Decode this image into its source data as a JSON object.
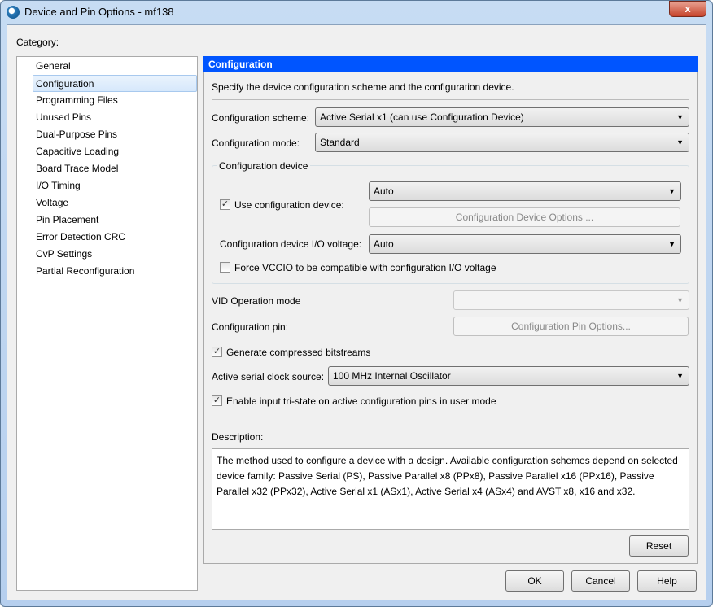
{
  "window": {
    "title": "Device and Pin Options - mf138",
    "close": "x"
  },
  "category_label": "Category:",
  "categories": [
    "General",
    "Configuration",
    "Programming Files",
    "Unused Pins",
    "Dual-Purpose Pins",
    "Capacitive Loading",
    "Board Trace Model",
    "I/O Timing",
    "Voltage",
    "Pin Placement",
    "Error Detection CRC",
    "CvP Settings",
    "Partial Reconfiguration"
  ],
  "selected_category": "Configuration",
  "panel": {
    "header": "Configuration",
    "intro": "Specify the device configuration scheme and the configuration device.",
    "scheme_label": "Configuration scheme:",
    "scheme_value": "Active Serial x1 (can use Configuration Device)",
    "mode_label": "Configuration mode:",
    "mode_value": "Standard",
    "group_title": "Configuration device",
    "use_device_label": "Use configuration device:",
    "use_device_checked": true,
    "device_value": "Auto",
    "device_options_button": "Configuration Device Options ...",
    "io_voltage_label": "Configuration device I/O voltage:",
    "io_voltage_value": "Auto",
    "force_vccio_label": "Force VCCIO to be compatible with configuration I/O voltage",
    "force_vccio_checked": false,
    "vid_label": "VID Operation mode",
    "vid_value": "",
    "pin_label": "Configuration pin:",
    "pin_button": "Configuration Pin Options...",
    "compress_label": "Generate compressed bitstreams",
    "compress_checked": true,
    "clock_label": "Active serial clock source:",
    "clock_value": "100 MHz Internal Oscillator",
    "tristate_label": "Enable input tri-state on active configuration pins in user mode",
    "tristate_checked": true,
    "description_label": "Description:",
    "description": "The method used to configure a device with a design. Available configuration schemes depend on selected device family: Passive Serial (PS), Passive Parallel x8 (PPx8), Passive Parallel x16 (PPx16), Passive Parallel x32 (PPx32), Active Serial x1 (ASx1), Active Serial x4 (ASx4) and AVST x8, x16 and x32.",
    "reset": "Reset"
  },
  "buttons": {
    "ok": "OK",
    "cancel": "Cancel",
    "help": "Help"
  },
  "arrow": "▼",
  "check": "✓"
}
